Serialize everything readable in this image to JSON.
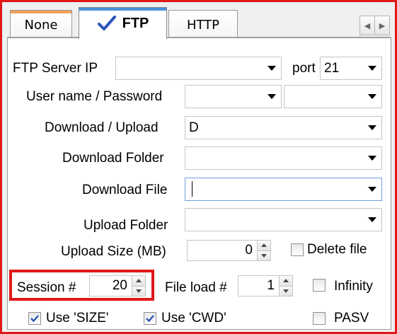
{
  "tabs": [
    {
      "label": "None",
      "accent": "#f0a15a"
    },
    {
      "label": "FTP",
      "accent": "#4a90d9",
      "active": true
    },
    {
      "label": "HTTP"
    }
  ],
  "icons": {
    "active_tab": "check-icon",
    "scroll_left": "arrow-left-icon",
    "scroll_right": "arrow-right-icon"
  },
  "ftp": {
    "server_ip_label": "FTP Server IP",
    "server_ip_value": "",
    "port_label": "port",
    "port_value": "21",
    "credentials_label": "User name / Password",
    "username_value": "",
    "password_value": "",
    "direction_label": "Download / Upload",
    "direction_value": "D",
    "download_folder_label": "Download Folder",
    "download_folder_value": "",
    "download_file_label": "Download File",
    "download_file_value": "",
    "upload_folder_label": "Upload Folder",
    "upload_folder_value": "",
    "upload_size_label": "Upload Size (MB)",
    "upload_size_value": "0",
    "delete_file_label": "Delete file",
    "delete_file_checked": false,
    "session_label": "Session #",
    "session_value": "20",
    "file_load_label": "File load #",
    "file_load_value": "1",
    "infinity_label": "Infinity",
    "infinity_checked": false,
    "use_size_label": "Use 'SIZE'",
    "use_size_checked": true,
    "use_cwd_label": "Use 'CWD'",
    "use_cwd_checked": true,
    "pasv_label": "PASV",
    "pasv_checked": false
  },
  "colors": {
    "highlight": "#e01818",
    "check": "#2a55b8",
    "focus_border": "#6f9fd8"
  }
}
